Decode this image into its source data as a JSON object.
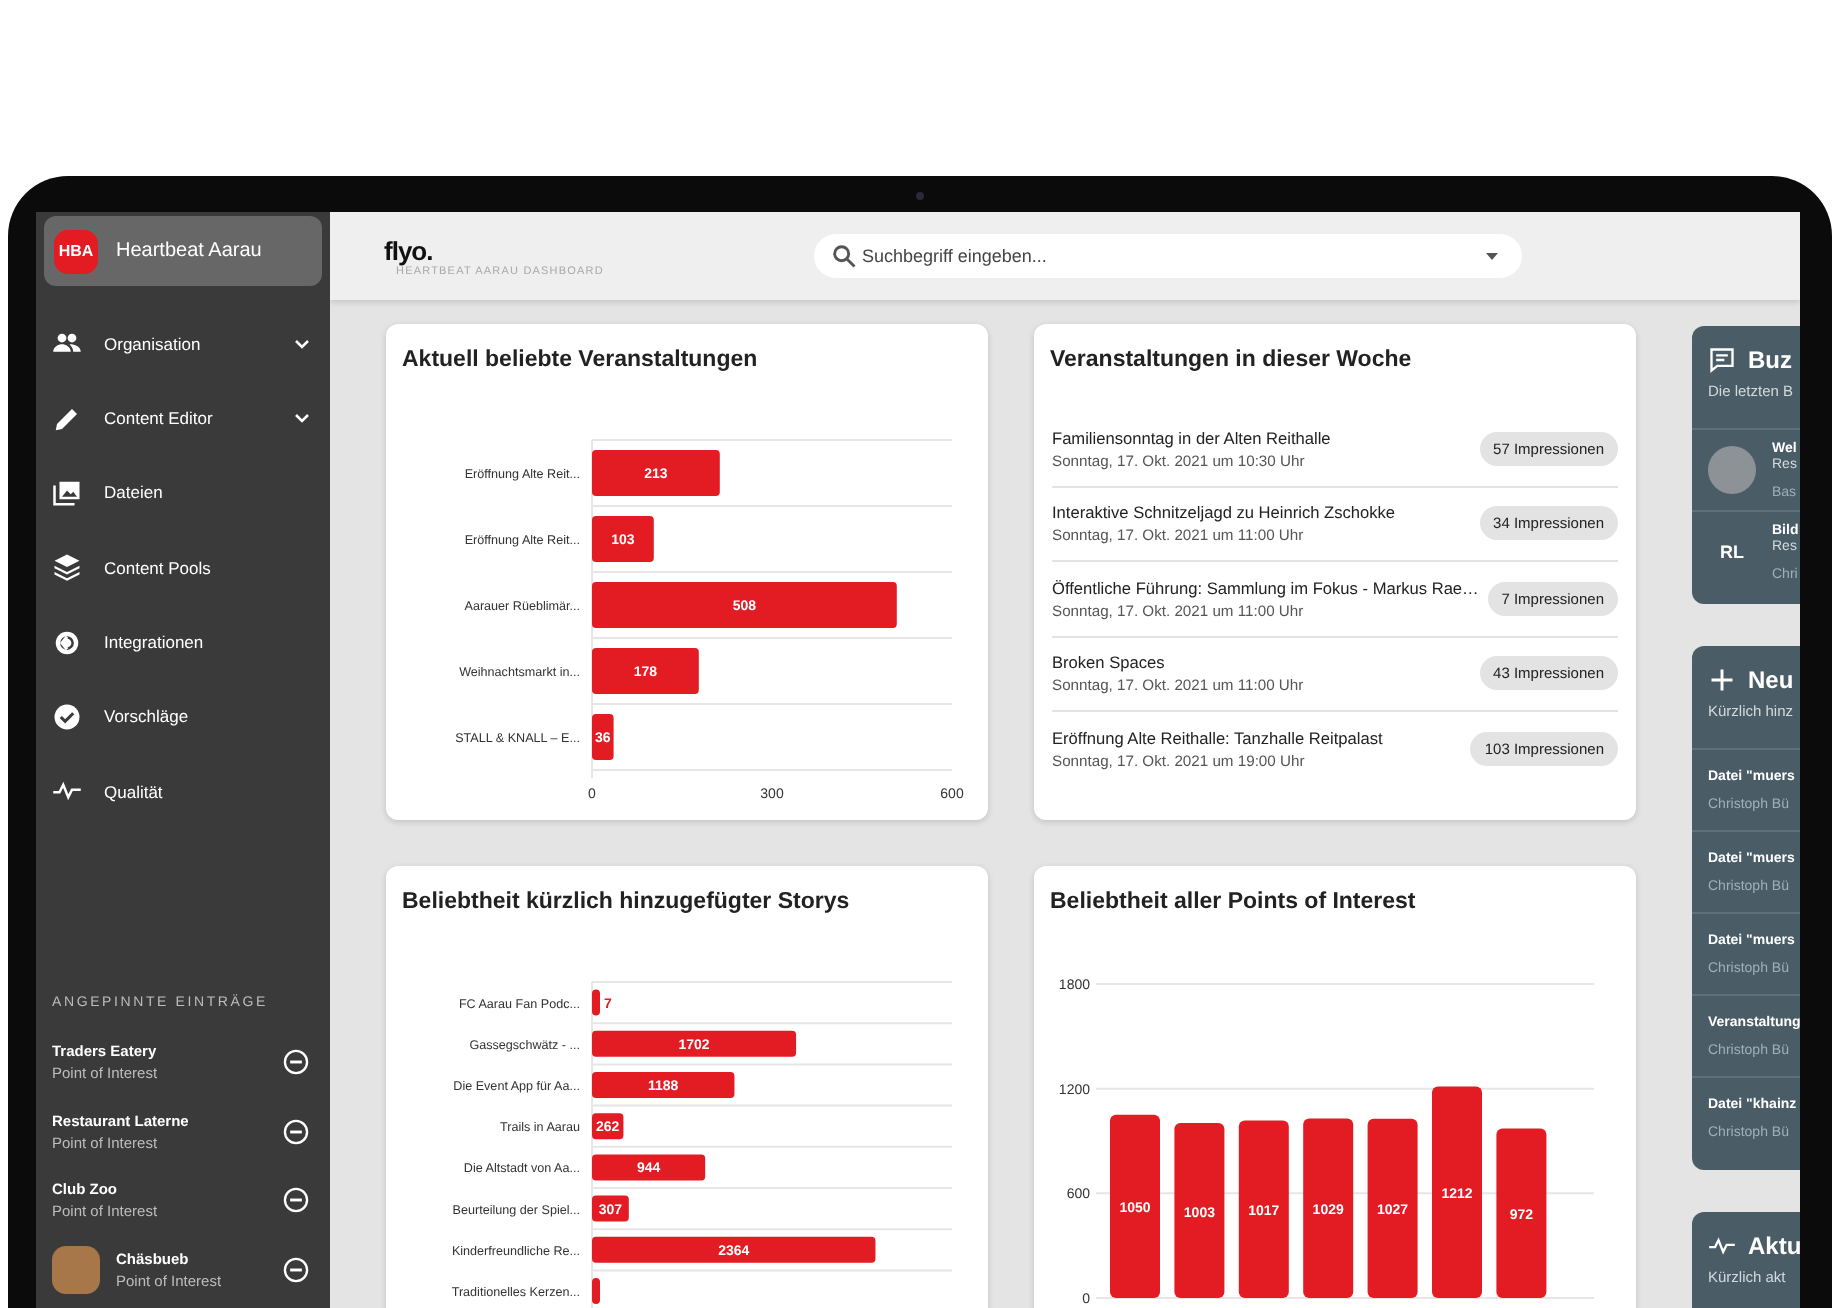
{
  "sidebar": {
    "org": {
      "initials": "HBA",
      "name": "Heartbeat Aarau"
    },
    "items": [
      {
        "label": "Organisation",
        "kind": "group",
        "expanded": false
      },
      {
        "label": "Content Editor",
        "kind": "group",
        "expanded": false
      },
      {
        "label": "Dateien",
        "kind": "link"
      },
      {
        "label": "Content Pools",
        "kind": "link"
      },
      {
        "label": "Integrationen",
        "kind": "link"
      },
      {
        "label": "Vorschläge",
        "kind": "link"
      },
      {
        "label": "Qualität",
        "kind": "link"
      }
    ],
    "pinned_heading": "ANGEPINNTE EINTRÄGE",
    "pinned": [
      {
        "title": "Traders Eatery",
        "subtitle": "Point of Interest",
        "kind": "text"
      },
      {
        "title": "Restaurant Laterne",
        "subtitle": "Point of Interest",
        "kind": "text"
      },
      {
        "title": "Club Zoo",
        "subtitle": "Point of Interest",
        "kind": "text"
      },
      {
        "title": "Chäsbueb",
        "subtitle": "Point of Interest",
        "kind": "photo"
      }
    ]
  },
  "topbar": {
    "logo": "flyo.",
    "breadcrumb": "HEARTBEAT AARAU DASHBOARD",
    "search": {
      "placeholder": "Suchbegriff eingeben..."
    }
  },
  "popular_events": {
    "title": "Aktuell beliebte Veranstaltungen",
    "chart_data": {
      "type": "bar",
      "orientation": "horizontal",
      "categories": [
        "Eröffnung Alte Reit...",
        "Eröffnung Alte Reit...",
        "Aarauer Rüeblimär...",
        "Weihnachtsmarkt in...",
        "STALL & KNALL – E..."
      ],
      "series": [
        {
          "color": "#e31b23",
          "values": [
            213,
            103,
            508,
            178,
            36
          ]
        }
      ],
      "xlim": [
        0,
        600
      ],
      "xticks": [
        0,
        300,
        600
      ],
      "data_labels": true
    }
  },
  "week_events": {
    "title": "Veranstaltungen in dieser Woche",
    "items": [
      {
        "title": "Familiensonntag in der Alten Reithalle",
        "date": "Sonntag, 17. Okt. 2021 um 10:30 Uhr",
        "badge": "57 Impressionen"
      },
      {
        "title": "Interaktive Schnitzeljagd zu Heinrich Zschokke",
        "date": "Sonntag, 17. Okt. 2021 um 11:00 Uhr",
        "badge": "34 Impressionen"
      },
      {
        "title": "Öffentliche Führung: Sammlung im Fokus - Markus Rae…",
        "date": "Sonntag, 17. Okt. 2021 um 11:00 Uhr",
        "badge": "7 Impressionen"
      },
      {
        "title": "Broken Spaces",
        "date": "Sonntag, 17. Okt. 2021 um 11:00 Uhr",
        "badge": "43 Impressionen"
      },
      {
        "title": "Eröffnung Alte Reithalle: Tanzhalle Reitpalast",
        "date": "Sonntag, 17. Okt. 2021 um 19:00 Uhr",
        "badge": "103 Impressionen"
      }
    ]
  },
  "recent_stories": {
    "title": "Beliebtheit kürzlich hinzugefügter Storys",
    "chart_data": {
      "type": "bar",
      "orientation": "horizontal",
      "categories": [
        "FC Aarau Fan Podc...",
        "Gassegschwätz - ...",
        "Die Event App für Aa...",
        "Trails in Aarau",
        "Die Altstadt von Aa...",
        "Beurteilung der Spiel...",
        "Kinderfreundliche Re...",
        "Traditionelles Kerzen..."
      ],
      "series": [
        {
          "color": "#e31b23",
          "values": [
            7,
            1702,
            1188,
            262,
            944,
            307,
            2364,
            null
          ]
        }
      ],
      "data_labels": true
    }
  },
  "points_of_interest": {
    "title": "Beliebtheit aller Points of Interest",
    "chart_data": {
      "type": "bar",
      "orientation": "vertical",
      "series": [
        {
          "color": "#e31b23",
          "values": [
            1050,
            1003,
            1017,
            1029,
            1027,
            1212,
            972
          ]
        }
      ],
      "ylim": [
        0,
        1800
      ],
      "yticks": [
        0,
        600,
        1200,
        1800
      ],
      "data_labels": true
    }
  },
  "right_panel": [
    {
      "title": "Buz",
      "subtitle": "Die letzten B",
      "items": [
        {
          "kind": "photo",
          "lines": [
            "Wel",
            "Res",
            "Bas"
          ]
        },
        {
          "kind": "initials",
          "initials": "RL",
          "lines": [
            "Bild",
            "Res",
            "Chri"
          ]
        }
      ]
    },
    {
      "title": "Neu",
      "subtitle": "Kürzlich hinz",
      "items": [
        {
          "kind": "plain",
          "lines": [
            "Datei \"muers",
            "Christoph Bü"
          ]
        },
        {
          "kind": "plain",
          "lines": [
            "Datei \"muers",
            "Christoph Bü"
          ]
        },
        {
          "kind": "plain",
          "lines": [
            "Datei \"muers",
            "Christoph Bü"
          ]
        },
        {
          "kind": "plain",
          "lines": [
            "Veranstaltung",
            "Christoph Bü"
          ]
        },
        {
          "kind": "plain",
          "lines": [
            "Datei \"khainz",
            "Christoph Bü"
          ]
        }
      ]
    },
    {
      "title": "Aktu",
      "subtitle": "Kürzlich akt"
    }
  ]
}
